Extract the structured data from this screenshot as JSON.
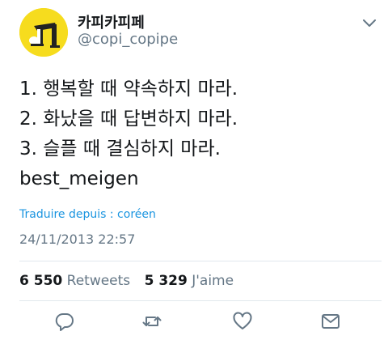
{
  "author": {
    "display_name": "카피카피페",
    "handle": "@copi_copipe"
  },
  "tweet": {
    "lines": [
      "1. 행복할 때 약속하지 마라.",
      "2. 화났을 때 답변하지 마라.",
      "3. 슬플 때 결심하지 마라.",
      "best_meigen"
    ],
    "translate_label": "Traduire depuis : coréen",
    "timestamp": "24/11/2013 22:57"
  },
  "stats": {
    "retweets_count": "6 550",
    "retweets_label": "Retweets",
    "likes_count": "5 329",
    "likes_label": "J'aime"
  },
  "icons": {
    "menu": "chevron-down-icon",
    "reply": "reply-icon",
    "retweet": "retweet-icon",
    "like": "heart-icon",
    "dm": "envelope-icon"
  },
  "colors": {
    "link": "#1b95e0",
    "secondary_text": "#657786",
    "icon": "#657786",
    "avatar_bg": "#f6dc1e"
  }
}
